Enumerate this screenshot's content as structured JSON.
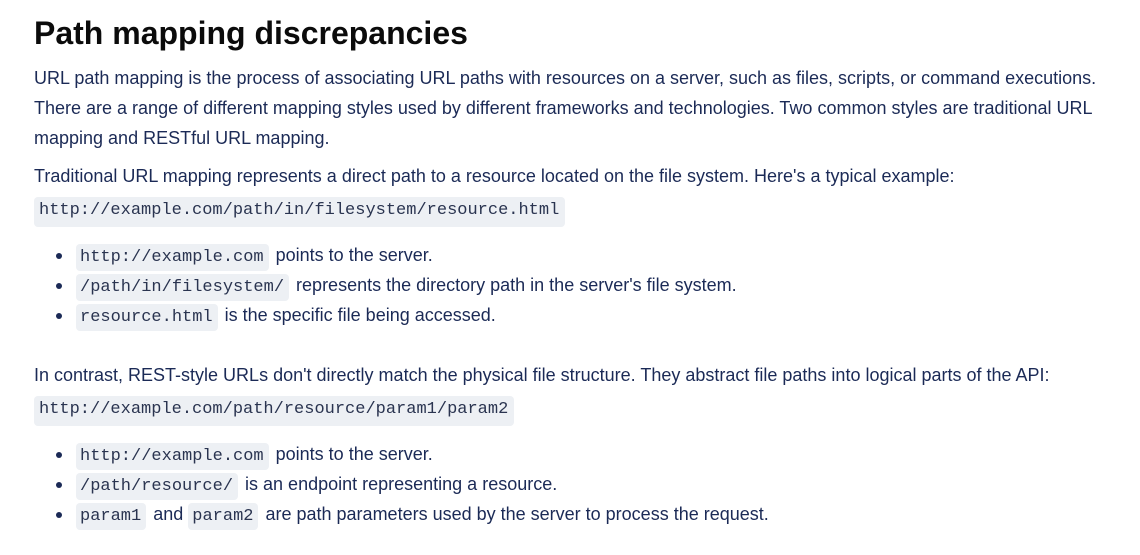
{
  "heading": "Path mapping discrepancies",
  "paragraph_1": "URL path mapping is the process of associating URL paths with resources on a server, such as files, scripts, or command executions. There are a range of different mapping styles used by different frameworks and technologies. Two common styles are traditional URL mapping and RESTful URL mapping.",
  "paragraph_2": "Traditional URL mapping represents a direct path to a resource located on the file system. Here's a typical example:",
  "code_example_1": "http://example.com/path/in/filesystem/resource.html",
  "list_1": [
    {
      "code": "http://example.com",
      "text": " points to the server."
    },
    {
      "code": "/path/in/filesystem/",
      "text": " represents the directory path in the server's file system."
    },
    {
      "code": "resource.html",
      "text": " is the specific file being accessed."
    }
  ],
  "paragraph_3": "In contrast, REST-style URLs don't directly match the physical file structure. They abstract file paths into logical parts of the API:",
  "code_example_2": "http://example.com/path/resource/param1/param2",
  "list_2": [
    {
      "code": "http://example.com",
      "text": " points to the server."
    },
    {
      "code": "/path/resource/",
      "text": " is an endpoint representing a resource."
    },
    {
      "code": "param1",
      "middle": " and ",
      "code2": "param2",
      "text": " are path parameters used by the server to process the request."
    }
  ],
  "colors": {
    "heading": "#0b0b0b",
    "body_text": "#1b2a56",
    "code_background": "#edf0f4"
  }
}
